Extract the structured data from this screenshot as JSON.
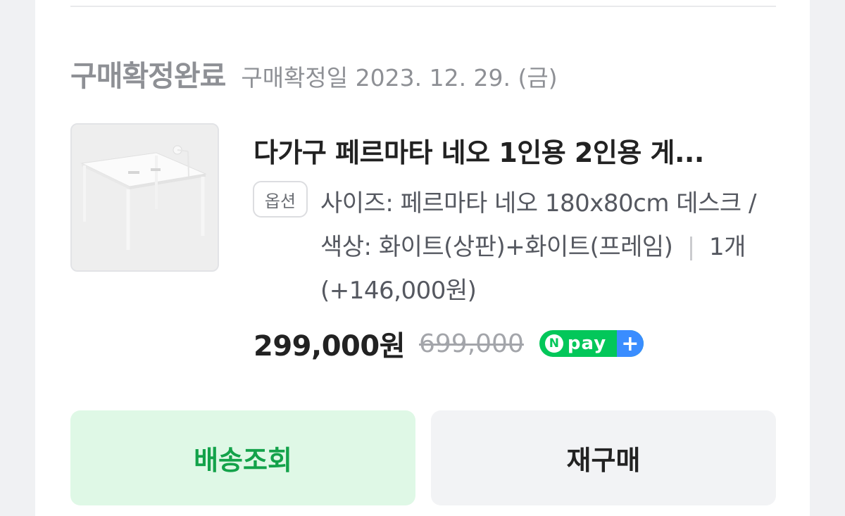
{
  "order": {
    "status_title": "구매확정완료",
    "status_date": "구매확정일 2023. 12. 29. (금)",
    "product_title": "다가구 페르마타 네오 1인용 2인용 게...",
    "option_badge": "옵션",
    "option_text": "사이즈: 페르마타 네오 180x80cm 데스크 / 색상: 화이트(상판)+화이트(프레임)",
    "quantity": "1개",
    "option_price": "(+146,000원)",
    "price": "299,000원",
    "original_price": "699,000",
    "npay_label": "pay",
    "npay_n": "N",
    "npay_plus": "+"
  },
  "buttons": {
    "track_label": "배송조회",
    "rebuy_label": "재구매"
  },
  "colors": {
    "background": "#f0f1f3",
    "npay_green": "#03c75a",
    "npay_blue": "#3a8dff",
    "track_button_bg": "#dff8e6",
    "track_button_text": "#13a24a"
  },
  "icons": {
    "payment_badge": "npay-plus-logo",
    "thumbnail": "white-desk-product-image"
  }
}
